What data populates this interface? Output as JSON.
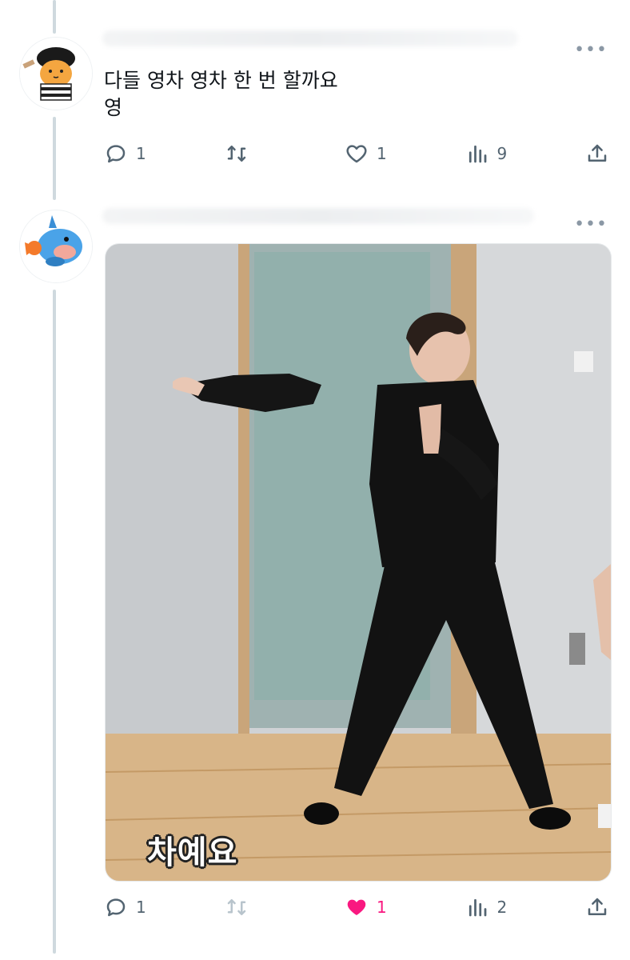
{
  "tweets": [
    {
      "avatar": "cartoon-chick-avatar",
      "text": "다들 영차 영차 한 번 할까요\n영",
      "actions": {
        "reply_count": "1",
        "retweet_count": "",
        "like_count": "1",
        "view_count": "9"
      }
    },
    {
      "avatar": "blue-fish-pokemon-avatar",
      "media_caption": "차예요",
      "actions": {
        "reply_count": "1",
        "retweet_count": "",
        "like_count": "1",
        "view_count": "2",
        "liked": true
      }
    }
  ],
  "colors": {
    "accent_like": "#f91880",
    "icon_gray": "#536471",
    "thread_line": "#cfd9de"
  }
}
